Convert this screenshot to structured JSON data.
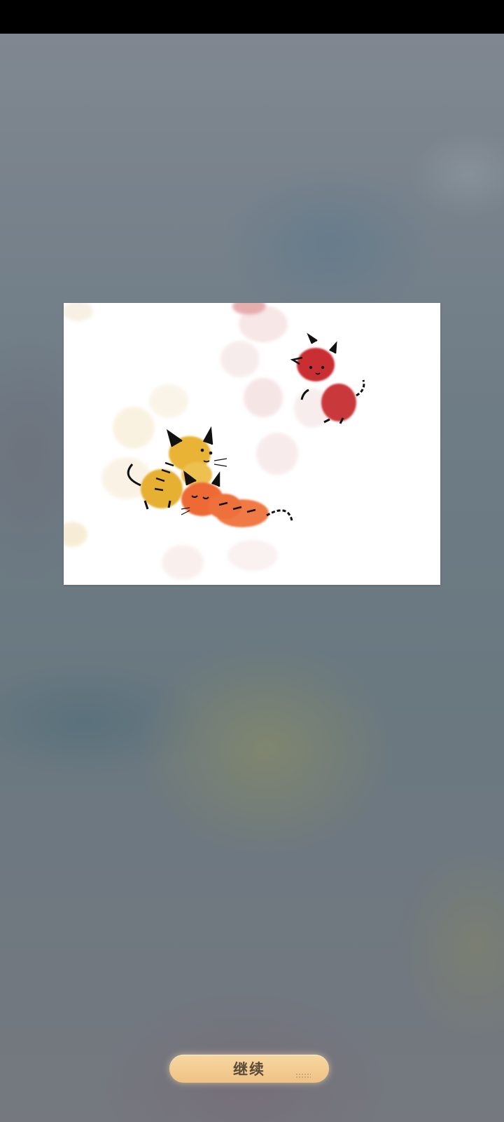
{
  "continue_button": {
    "label": "继续"
  },
  "colors": {
    "button_top": "#f7d7a0",
    "button_bottom": "#efc286",
    "button_text": "#5a4a3a",
    "card_background": "#ffffff"
  },
  "illustration": {
    "subject": "fingerprint-cats-illustration"
  }
}
